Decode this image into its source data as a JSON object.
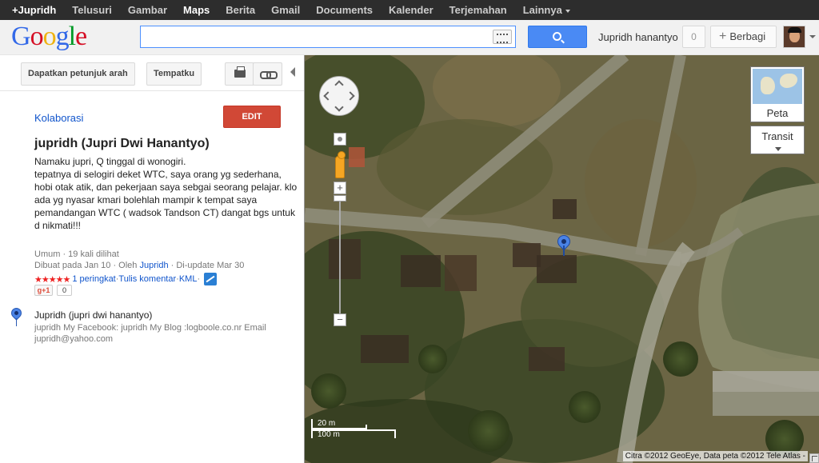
{
  "topbar": {
    "items": [
      "+Jupridh",
      "Telusuri",
      "Gambar",
      "Maps",
      "Berita",
      "Gmail",
      "Documents",
      "Kalender",
      "Terjemahan",
      "Lainnya"
    ]
  },
  "header": {
    "logo": "Google",
    "search_value": "",
    "username": "Jupridh hanantyo",
    "notif_count": "0",
    "share_label": "Berbagi"
  },
  "toolbar": {
    "directions_label": "Dapatkan petunjuk arah",
    "myplaces_label": "Tempatku"
  },
  "map_info": {
    "collab_label": "Kolaborasi",
    "edit_label": "EDIT",
    "title": "jupridh (Jupri Dwi Hanantyo)",
    "description": "Namaku jupri, Q tinggal di wonogiri.\ntepatnya di selogiri deket WTC, saya orang yg sederhana,\nhobi otak atik, dan pekerjaan saya sebgai seorang pelajar. klo ada yg nyasar kmari bolehlah mampir k tempat saya pemandangan WTC ( wadsok Tandson CT) dangat bgs untuk d nikmati!!!",
    "visibility": "Umum · 19 kali dilihat",
    "created_prefix": "Dibuat pada Jan 10 · Oleh ",
    "author": "Jupridh",
    "updated": " · Di-update Mar 30",
    "stars": "★★★★★",
    "rating_link": "1 peringkat",
    "sep1": " · ",
    "comment_link": "Tulis komentar",
    "sep2": " · ",
    "kml_link": "KML",
    "sep3": " · ",
    "gplus_label": "g+1",
    "gplus_count": "0"
  },
  "place": {
    "title": "Jupridh (jupri dwi hanantyo)",
    "description": "jupridh My Facebook: jupridh My Blog        :logboole.co.nr Email jupridh@yahoo.com"
  },
  "map_controls": {
    "maptype_label": "Peta",
    "transit_label": "Transit",
    "scale_small": "20 m",
    "scale_large": "100 m",
    "copyright": "Citra ©2012 GeoEye, Data peta ©2012 Tele Atlas -"
  }
}
